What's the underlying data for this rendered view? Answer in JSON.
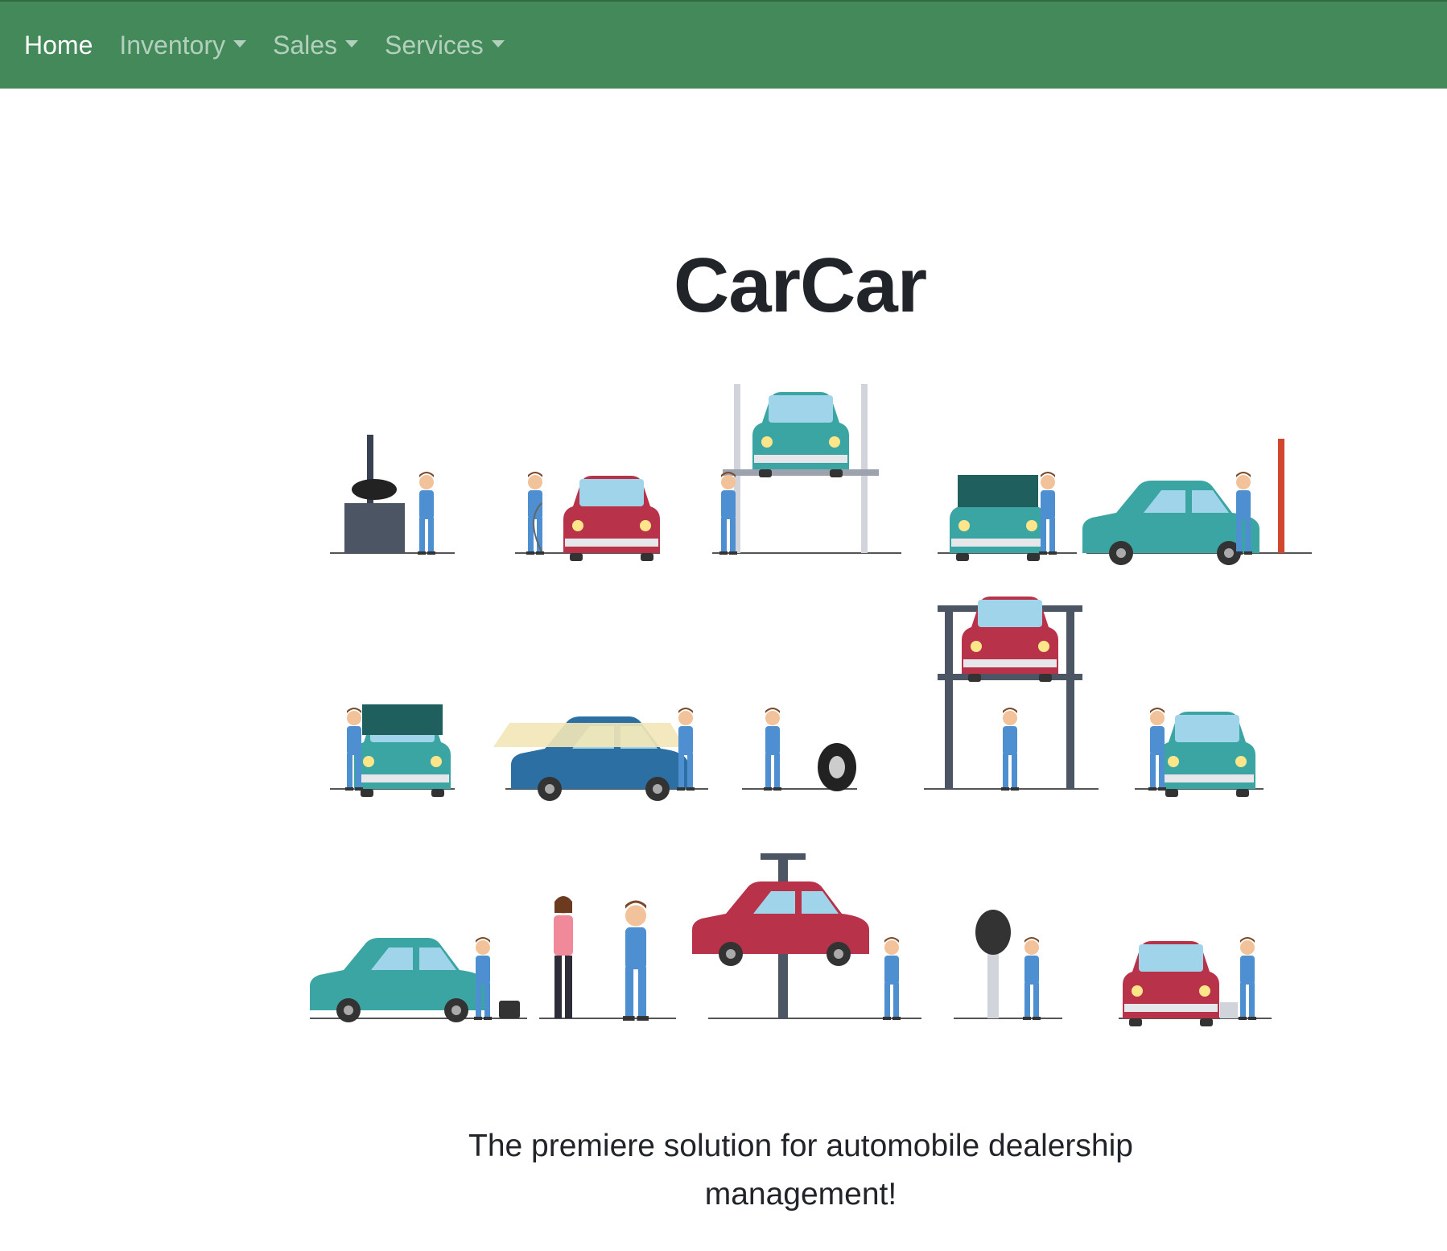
{
  "nav": {
    "home": "Home",
    "inventory": "Inventory",
    "sales": "Sales",
    "services": "Services"
  },
  "hero": {
    "title": "CarCar",
    "tagline": "The premiere solution for automobile dealership management!"
  },
  "colors": {
    "navbar": "#43895a",
    "teal_car": "#3ba5a3",
    "red_car": "#b8324a",
    "blue_car": "#2c6fa3",
    "mechanic_uniform": "#4d8fd1"
  }
}
